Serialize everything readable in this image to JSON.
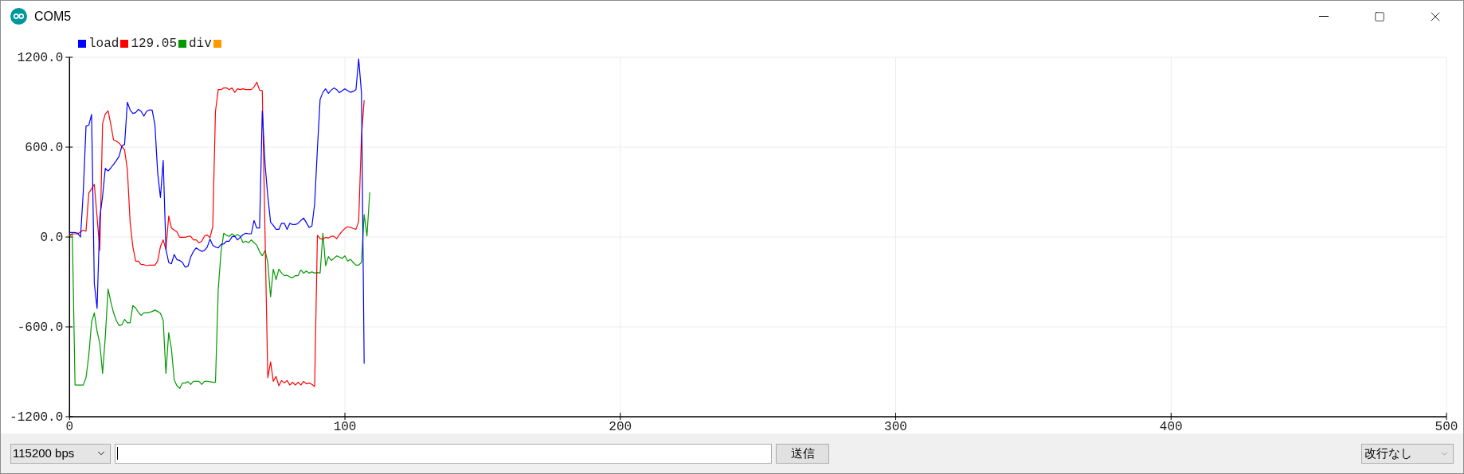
{
  "window": {
    "title": "COM5"
  },
  "plot": {
    "chart_data": {
      "type": "line",
      "x": [
        0,
        1,
        2,
        3,
        4,
        5,
        6,
        7,
        8,
        9,
        10,
        11,
        12,
        13,
        14,
        15,
        16,
        17,
        18,
        19,
        20,
        21,
        22,
        23,
        24,
        25,
        26,
        27,
        28,
        29,
        30,
        31,
        32,
        33,
        34,
        35,
        36,
        37,
        38,
        39,
        40,
        41,
        42,
        43,
        44,
        45,
        46,
        47,
        48,
        49,
        50,
        51,
        52,
        53,
        54,
        55,
        56,
        57,
        58,
        59,
        60,
        61,
        62,
        63,
        64,
        65,
        66,
        67,
        68,
        69,
        70,
        71,
        72,
        73,
        74,
        75,
        76,
        77,
        78,
        79,
        80,
        81,
        82,
        83,
        84,
        85,
        86,
        87,
        88,
        89,
        90,
        91,
        92,
        93,
        94,
        95,
        96,
        97,
        98,
        99,
        100,
        101,
        102,
        103,
        104,
        105,
        106,
        107,
        108,
        109
      ],
      "series": [
        {
          "name": "load",
          "color": "#0000ff",
          "values": [
            30,
            30,
            30,
            25,
            0,
            308,
            740,
            747,
            818,
            -311,
            -476,
            130,
            272,
            458,
            440,
            462,
            485,
            511,
            538,
            609,
            618,
            900,
            848,
            825,
            830,
            853,
            839,
            807,
            839,
            848,
            848,
            750,
            432,
            264,
            512,
            -81,
            -170,
            -179,
            -117,
            -152,
            -156,
            -170,
            -202,
            -196,
            -134,
            -96,
            -73,
            -85,
            -96,
            -90,
            -67,
            -14,
            -55,
            -67,
            -73,
            -50,
            -46,
            -28,
            -28,
            2,
            4,
            -19,
            -2,
            16,
            25,
            21,
            21,
            110,
            60,
            60,
            842,
            485,
            272,
            99,
            78,
            51,
            51,
            92,
            92,
            51,
            92,
            83,
            83,
            92,
            110,
            127,
            96,
            64,
            73,
            219,
            591,
            919,
            966,
            989,
            959,
            980,
            995,
            984,
            963,
            977,
            989,
            977,
            966,
            972,
            984,
            1189,
            963,
            -846,
            null,
            null
          ]
        },
        {
          "name": "129.05",
          "color": "#ff0000",
          "values": [
            7,
            21,
            21,
            21,
            34,
            46,
            39,
            294,
            322,
            352,
            131,
            -90,
            759,
            821,
            842,
            750,
            648,
            641,
            627,
            605,
            582,
            450,
            96,
            -64,
            -161,
            -161,
            -184,
            -184,
            -191,
            -188,
            -188,
            -188,
            -161,
            -64,
            -19,
            -85,
            140,
            60,
            46,
            34,
            -2,
            -2,
            -2,
            4,
            4,
            -19,
            -19,
            -39,
            -28,
            7,
            14,
            -4,
            69,
            839,
            984,
            984,
            995,
            995,
            984,
            995,
            966,
            989,
            984,
            989,
            984,
            984,
            984,
            1002,
            1034,
            980,
            977,
            7,
            -940,
            -834,
            -963,
            -931,
            -993,
            -958,
            -975,
            -958,
            -988,
            -970,
            -988,
            -970,
            -988,
            -963,
            -980,
            -975,
            -984,
            -998,
            11,
            -11,
            -14,
            -2,
            -7,
            4,
            4,
            -11,
            16,
            39,
            57,
            69,
            64,
            57,
            51,
            104,
            671,
            913,
            null,
            null
          ]
        },
        {
          "name": "div",
          "color": "#009900",
          "values": [
            16,
            20,
            -988,
            -988,
            -988,
            -988,
            -940,
            -789,
            -568,
            -506,
            -630,
            -710,
            -910,
            -666,
            -347,
            -435,
            -506,
            -559,
            -591,
            -586,
            -550,
            -573,
            -573,
            -457,
            -474,
            -503,
            -524,
            -506,
            -506,
            -503,
            -497,
            -488,
            -497,
            -510,
            -556,
            -910,
            -639,
            -745,
            -953,
            -993,
            -1011,
            -975,
            -975,
            -966,
            -984,
            -963,
            -963,
            -963,
            -984,
            -963,
            -963,
            -966,
            -970,
            -970,
            -347,
            -99,
            25,
            11,
            4,
            21,
            7,
            16,
            4,
            -37,
            -28,
            -39,
            -19,
            -37,
            -55,
            -99,
            -126,
            -90,
            -170,
            -400,
            -214,
            -285,
            -214,
            -241,
            -258,
            -255,
            -267,
            -272,
            -258,
            -258,
            -221,
            -241,
            -227,
            -241,
            -232,
            -241,
            -237,
            -241,
            25,
            -191,
            -131,
            -156,
            -143,
            -126,
            -134,
            -143,
            -126,
            -161,
            -149,
            -170,
            -188,
            -188,
            -170,
            149,
            7,
            299
          ]
        },
        {
          "color": "#ff9900",
          "values": [
            null,
            null,
            null,
            null,
            null,
            null,
            null,
            null,
            null,
            null,
            null,
            null,
            null,
            null,
            null,
            null,
            null,
            null,
            null,
            null,
            null,
            null,
            null,
            null,
            null,
            null,
            null,
            null,
            null,
            null,
            null,
            null,
            null,
            null,
            null,
            null,
            null,
            null,
            null,
            null,
            null,
            null,
            null,
            null,
            null,
            null,
            null,
            null,
            null,
            null,
            null,
            null,
            null,
            null,
            null,
            null,
            null,
            null,
            null,
            null,
            null,
            null,
            null,
            null,
            null,
            null,
            null,
            null,
            null,
            null,
            null,
            null,
            null,
            null,
            null,
            null,
            null,
            null,
            null,
            null,
            null,
            null,
            null,
            null,
            null,
            null,
            null,
            null,
            null,
            null,
            null,
            null,
            null,
            null,
            null,
            null,
            null,
            null,
            null,
            null,
            null,
            null,
            null,
            null,
            null,
            null,
            null,
            null,
            null,
            null
          ]
        }
      ],
      "grid": true,
      "legend": "top-left",
      "xlim": [
        0,
        500
      ],
      "ylim": [
        -1200,
        1200
      ],
      "xticks": [
        0,
        100,
        200,
        300,
        400,
        500
      ],
      "yticks": [
        {
          "value": 1200,
          "label": "1200.0"
        },
        {
          "value": 600,
          "label": "600.0"
        },
        {
          "value": 0,
          "label": "0.0"
        },
        {
          "value": -600,
          "label": "-600.0"
        },
        {
          "value": -1200,
          "label": "-1200.0"
        }
      ]
    }
  },
  "bottom_bar": {
    "baud_rate": {
      "value": "115200 bps"
    },
    "send_button": "送信",
    "line_ending": {
      "value": "改行なし"
    }
  }
}
